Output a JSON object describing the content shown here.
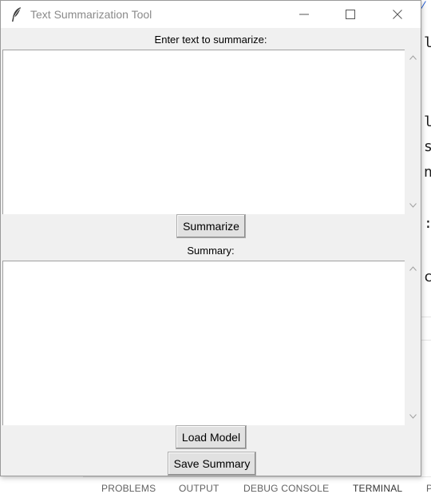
{
  "window": {
    "title": "Text Summarization Tool",
    "icon": "feather-icon",
    "controls": [
      "minimize-icon",
      "maximize-icon",
      "close-icon"
    ]
  },
  "input_section": {
    "label": "Enter text to summarize:",
    "value": ""
  },
  "summarize_button": {
    "label": "Summarize"
  },
  "summary_section": {
    "label": "Summary:",
    "value": ""
  },
  "load_model_button": {
    "label": "Load Model"
  },
  "save_summary_button": {
    "label": "Save Summary"
  },
  "background_editor": {
    "code_fragments": [
      "li",
      "le",
      "su",
      "nc",
      ":",
      "co"
    ],
    "panel_tabs": [
      "PROBLEMS",
      "OUTPUT",
      "DEBUG CONSOLE",
      "TERMINAL",
      "P"
    ],
    "active_tab": "TERMINAL"
  }
}
